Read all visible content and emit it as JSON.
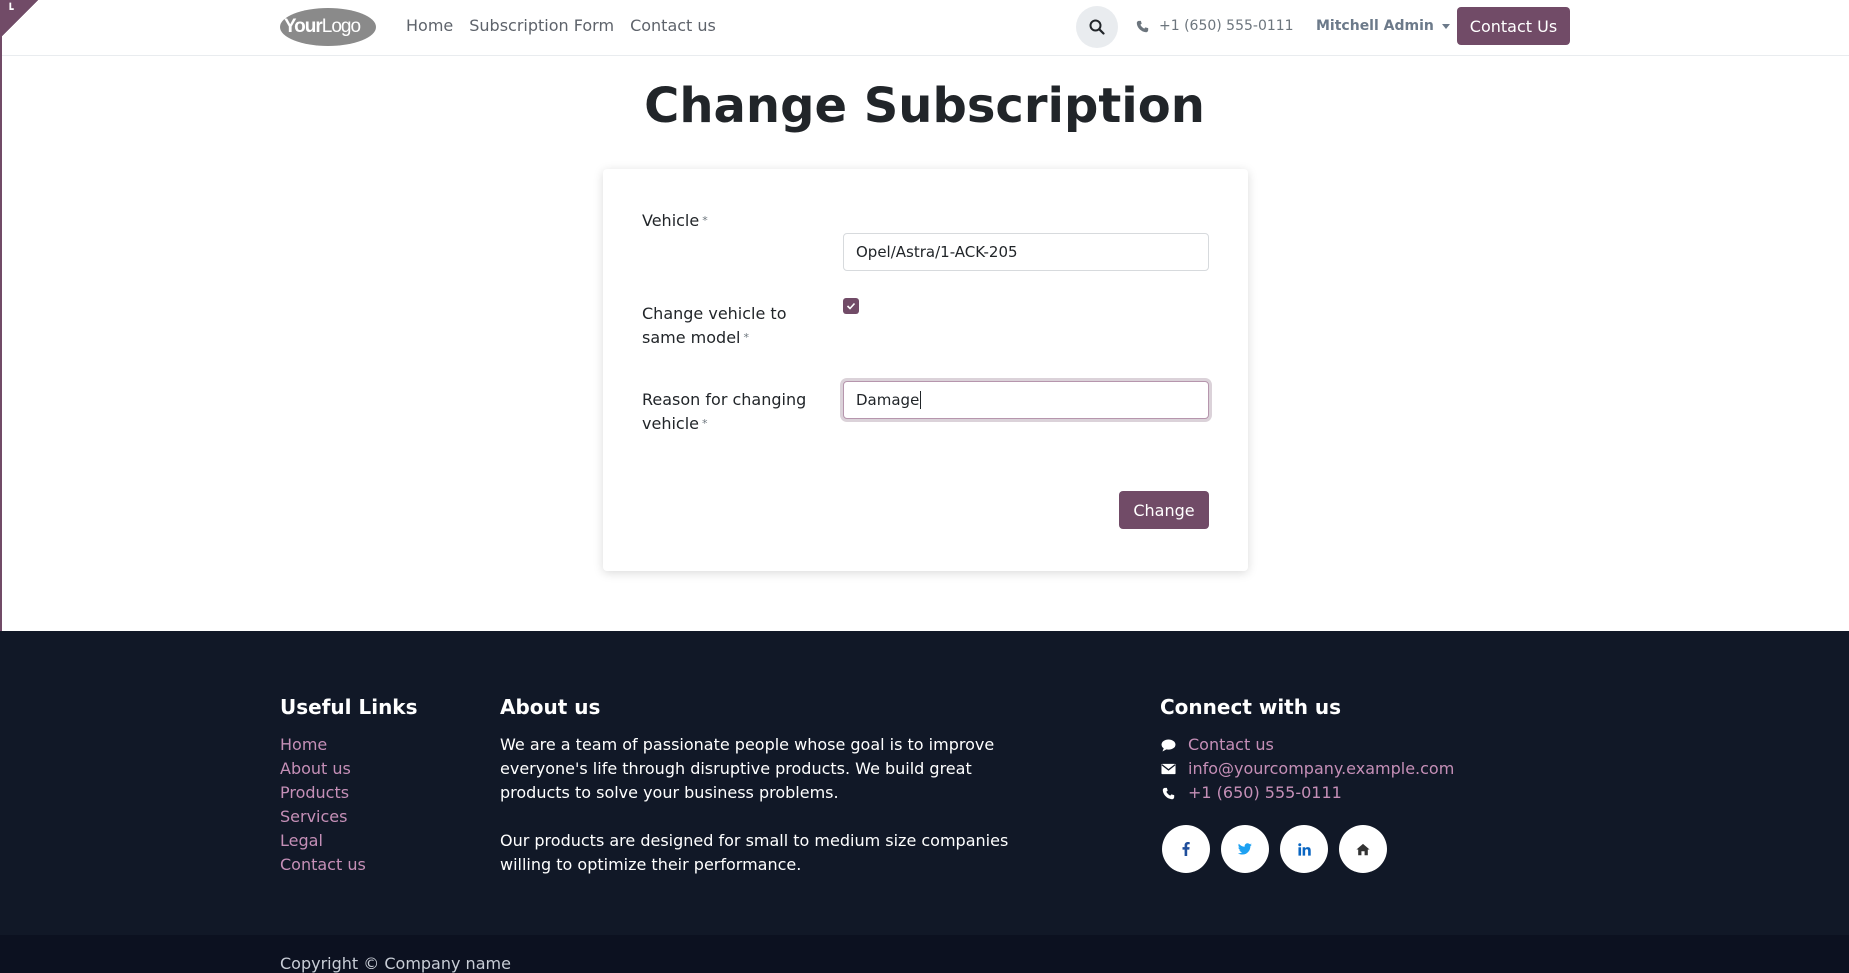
{
  "header": {
    "logo_text_1": "Your",
    "logo_text_2": "Logo",
    "nav": [
      {
        "label": "Home"
      },
      {
        "label": "Subscription Form"
      },
      {
        "label": "Contact us"
      }
    ],
    "phone": "+1 (650) 555-0111",
    "user": "Mitchell Admin",
    "contact_button": "Contact Us"
  },
  "main": {
    "title": "Change Subscription",
    "form": {
      "vehicle_label": "Vehicle",
      "vehicle_value": "Opel/Astra/1-ACK-205",
      "change_vehicle_label": "Change vehicle to same model",
      "change_vehicle_checked": true,
      "reason_label": "Reason for changing vehicle",
      "reason_value": "Damage",
      "required_marker": "*",
      "submit": "Change"
    }
  },
  "footer": {
    "useful_links_title": "Useful Links",
    "useful_links": [
      "Home",
      "About us",
      "Products",
      "Services",
      "Legal",
      "Contact us"
    ],
    "about_title": "About us",
    "about_p1": "We are a team of passionate people whose goal is to improve everyone's life through disruptive products. We build great products to solve your business problems.",
    "about_p2": "Our products are designed for small to medium size companies willing to optimize their performance.",
    "connect_title": "Connect with us",
    "contact_us": "Contact us",
    "email": "info@yourcompany.example.com",
    "phone": "+1 (650) 555-0111",
    "socials": [
      "facebook-icon",
      "twitter-icon",
      "linkedin-icon",
      "home-icon"
    ],
    "copyright": "Copyright © Company name"
  },
  "colors": {
    "brand": "#714b67",
    "footer_bg": "#111827",
    "footer_link": "#c58fb7"
  }
}
